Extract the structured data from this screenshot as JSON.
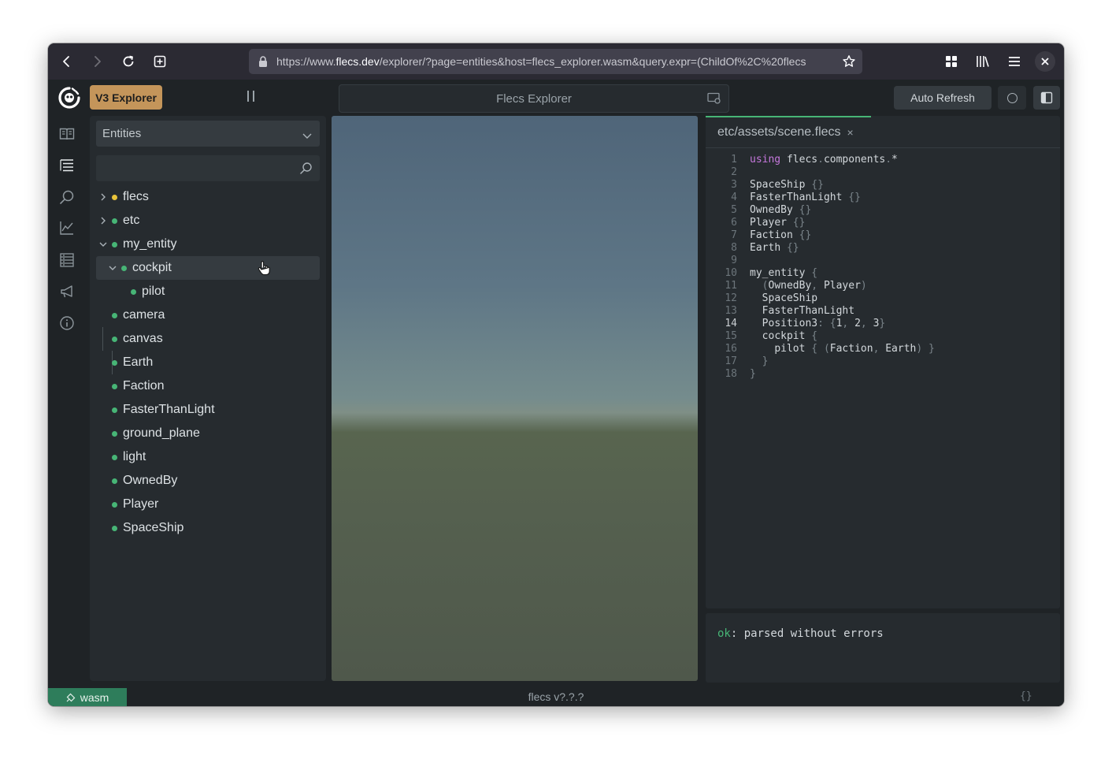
{
  "browser": {
    "url_prefix": "https://www.",
    "url_domain": "flecs.dev",
    "url_rest": "/explorer/?page=entities&host=flecs_explorer.wasm&query.expr=(ChildOf%2C%20flecs"
  },
  "app": {
    "badge": "V3 Explorer",
    "title": "Flecs Explorer",
    "auto_refresh": "Auto Refresh"
  },
  "tree": {
    "dropdown": "Entities",
    "search_placeholder": "",
    "items": [
      {
        "label": "flecs",
        "dot": "#e8c33a",
        "expander": "collapsed"
      },
      {
        "label": "etc",
        "dot": "#47b576",
        "expander": "collapsed"
      },
      {
        "label": "my_entity",
        "dot": "#47b576",
        "expander": "expanded"
      },
      {
        "label": "cockpit",
        "dot": "#47b576",
        "expander": "expanded",
        "selected": true
      },
      {
        "label": "pilot",
        "dot": "#47b576"
      },
      {
        "label": "camera",
        "dot": "#47b576"
      },
      {
        "label": "canvas",
        "dot": "#47b576"
      },
      {
        "label": "Earth",
        "dot": "#47b576"
      },
      {
        "label": "Faction",
        "dot": "#47b576"
      },
      {
        "label": "FasterThanLight",
        "dot": "#47b576"
      },
      {
        "label": "ground_plane",
        "dot": "#47b576"
      },
      {
        "label": "light",
        "dot": "#47b576"
      },
      {
        "label": "OwnedBy",
        "dot": "#47b576"
      },
      {
        "label": "Player",
        "dot": "#47b576"
      },
      {
        "label": "SpaceShip",
        "dot": "#47b576"
      }
    ]
  },
  "editor": {
    "tab": "etc/assets/scene.flecs",
    "current_line": 14,
    "lines": [
      "using flecs.components.*",
      "",
      "SpaceShip {}",
      "FasterThanLight {}",
      "OwnedBy {}",
      "Player {}",
      "Faction {}",
      "Earth {}",
      "",
      "my_entity {",
      "  (OwnedBy, Player)",
      "  SpaceShip",
      "  FasterThanLight",
      "  Position3: {1, 2, 3}",
      "  cockpit {",
      "    pilot { (Faction, Earth) }",
      "  }",
      "}"
    ]
  },
  "output": {
    "status": "ok",
    "message": ": parsed without errors"
  },
  "status_bar": {
    "connection": "wasm",
    "version": "flecs v?.?.?",
    "braces": "{}"
  },
  "colors": {
    "accent_green": "#47b576",
    "badge": "#c4955a",
    "status_green": "#2e7d5b"
  }
}
